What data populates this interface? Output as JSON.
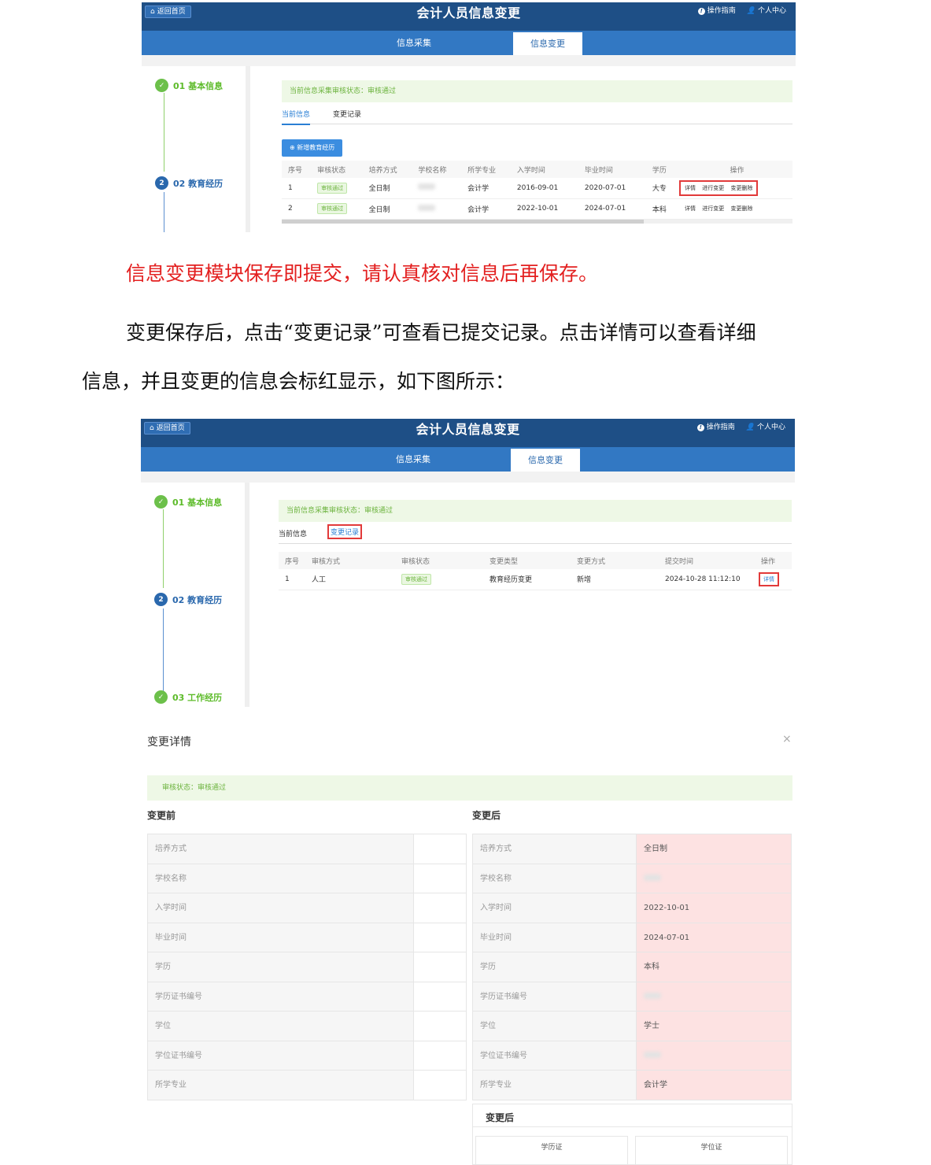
{
  "app": {
    "home_label": "返回首页",
    "title": "会计人员信息变更",
    "guide_label": "操作指南",
    "user_center_label": "个人中心",
    "tabs": [
      "信息采集",
      "信息变更"
    ]
  },
  "screen1": {
    "steps": [
      "01 基本信息",
      "02 教育经历"
    ],
    "notice": "当前信息采集审核状态：审核通过",
    "subtabs": [
      "当前信息",
      "变更记录"
    ],
    "add_button": "新增教育经历",
    "columns": [
      "序号",
      "审核状态",
      "培养方式",
      "学校名称",
      "所学专业",
      "入学时间",
      "毕业时间",
      "学历",
      "操作"
    ],
    "rows": [
      {
        "no": "1",
        "status": "审核通过",
        "mode": "全日制",
        "major": "会计学",
        "start": "2016-09-01",
        "end": "2020-07-01",
        "degree": "大专"
      },
      {
        "no": "2",
        "status": "审核通过",
        "mode": "全日制",
        "major": "会计学",
        "start": "2022-10-01",
        "end": "2024-07-01",
        "degree": "本科"
      }
    ],
    "ops": [
      "详情",
      "进行变更",
      "变更删除"
    ]
  },
  "paragraphs": {
    "warning": "信息变更模块保存即提交，请认真核对信息后再保存。",
    "line1": "变更保存后，点击“变更记录”可查看已提交记录。点击详情可以查看详细",
    "line2": "信息，并且变更的信息会标红显示，如下图所示："
  },
  "screen2": {
    "steps": [
      "01 基本信息",
      "02 教育经历",
      "03 工作经历"
    ],
    "notice": "当前信息采集审核状态：审核通过",
    "subtabs": [
      "当前信息",
      "变更记录"
    ],
    "columns": [
      "序号",
      "审核方式",
      "审核状态",
      "变更类型",
      "变更方式",
      "提交时间",
      "操作"
    ],
    "row": {
      "no": "1",
      "method": "人工",
      "status": "审核通过",
      "type": "教育经历变更",
      "way": "新增",
      "time": "2024-10-28 11:12:10",
      "op": "详情"
    }
  },
  "detail": {
    "title": "变更详情",
    "close": "×",
    "notice": "审核状态：审核通过",
    "before_label": "变更前",
    "after_label": "变更后",
    "fields": [
      "培养方式",
      "学校名称",
      "入学时间",
      "毕业时间",
      "学历",
      "学历证书编号",
      "学位",
      "学位证书编号",
      "所学专业"
    ],
    "after_values": [
      "全日制",
      "",
      "2022-10-01",
      "2024-07-01",
      "本科",
      "",
      "学士",
      "",
      "会计学"
    ],
    "panel_title": "变更后",
    "certs": [
      "学历证",
      "学位证"
    ]
  }
}
